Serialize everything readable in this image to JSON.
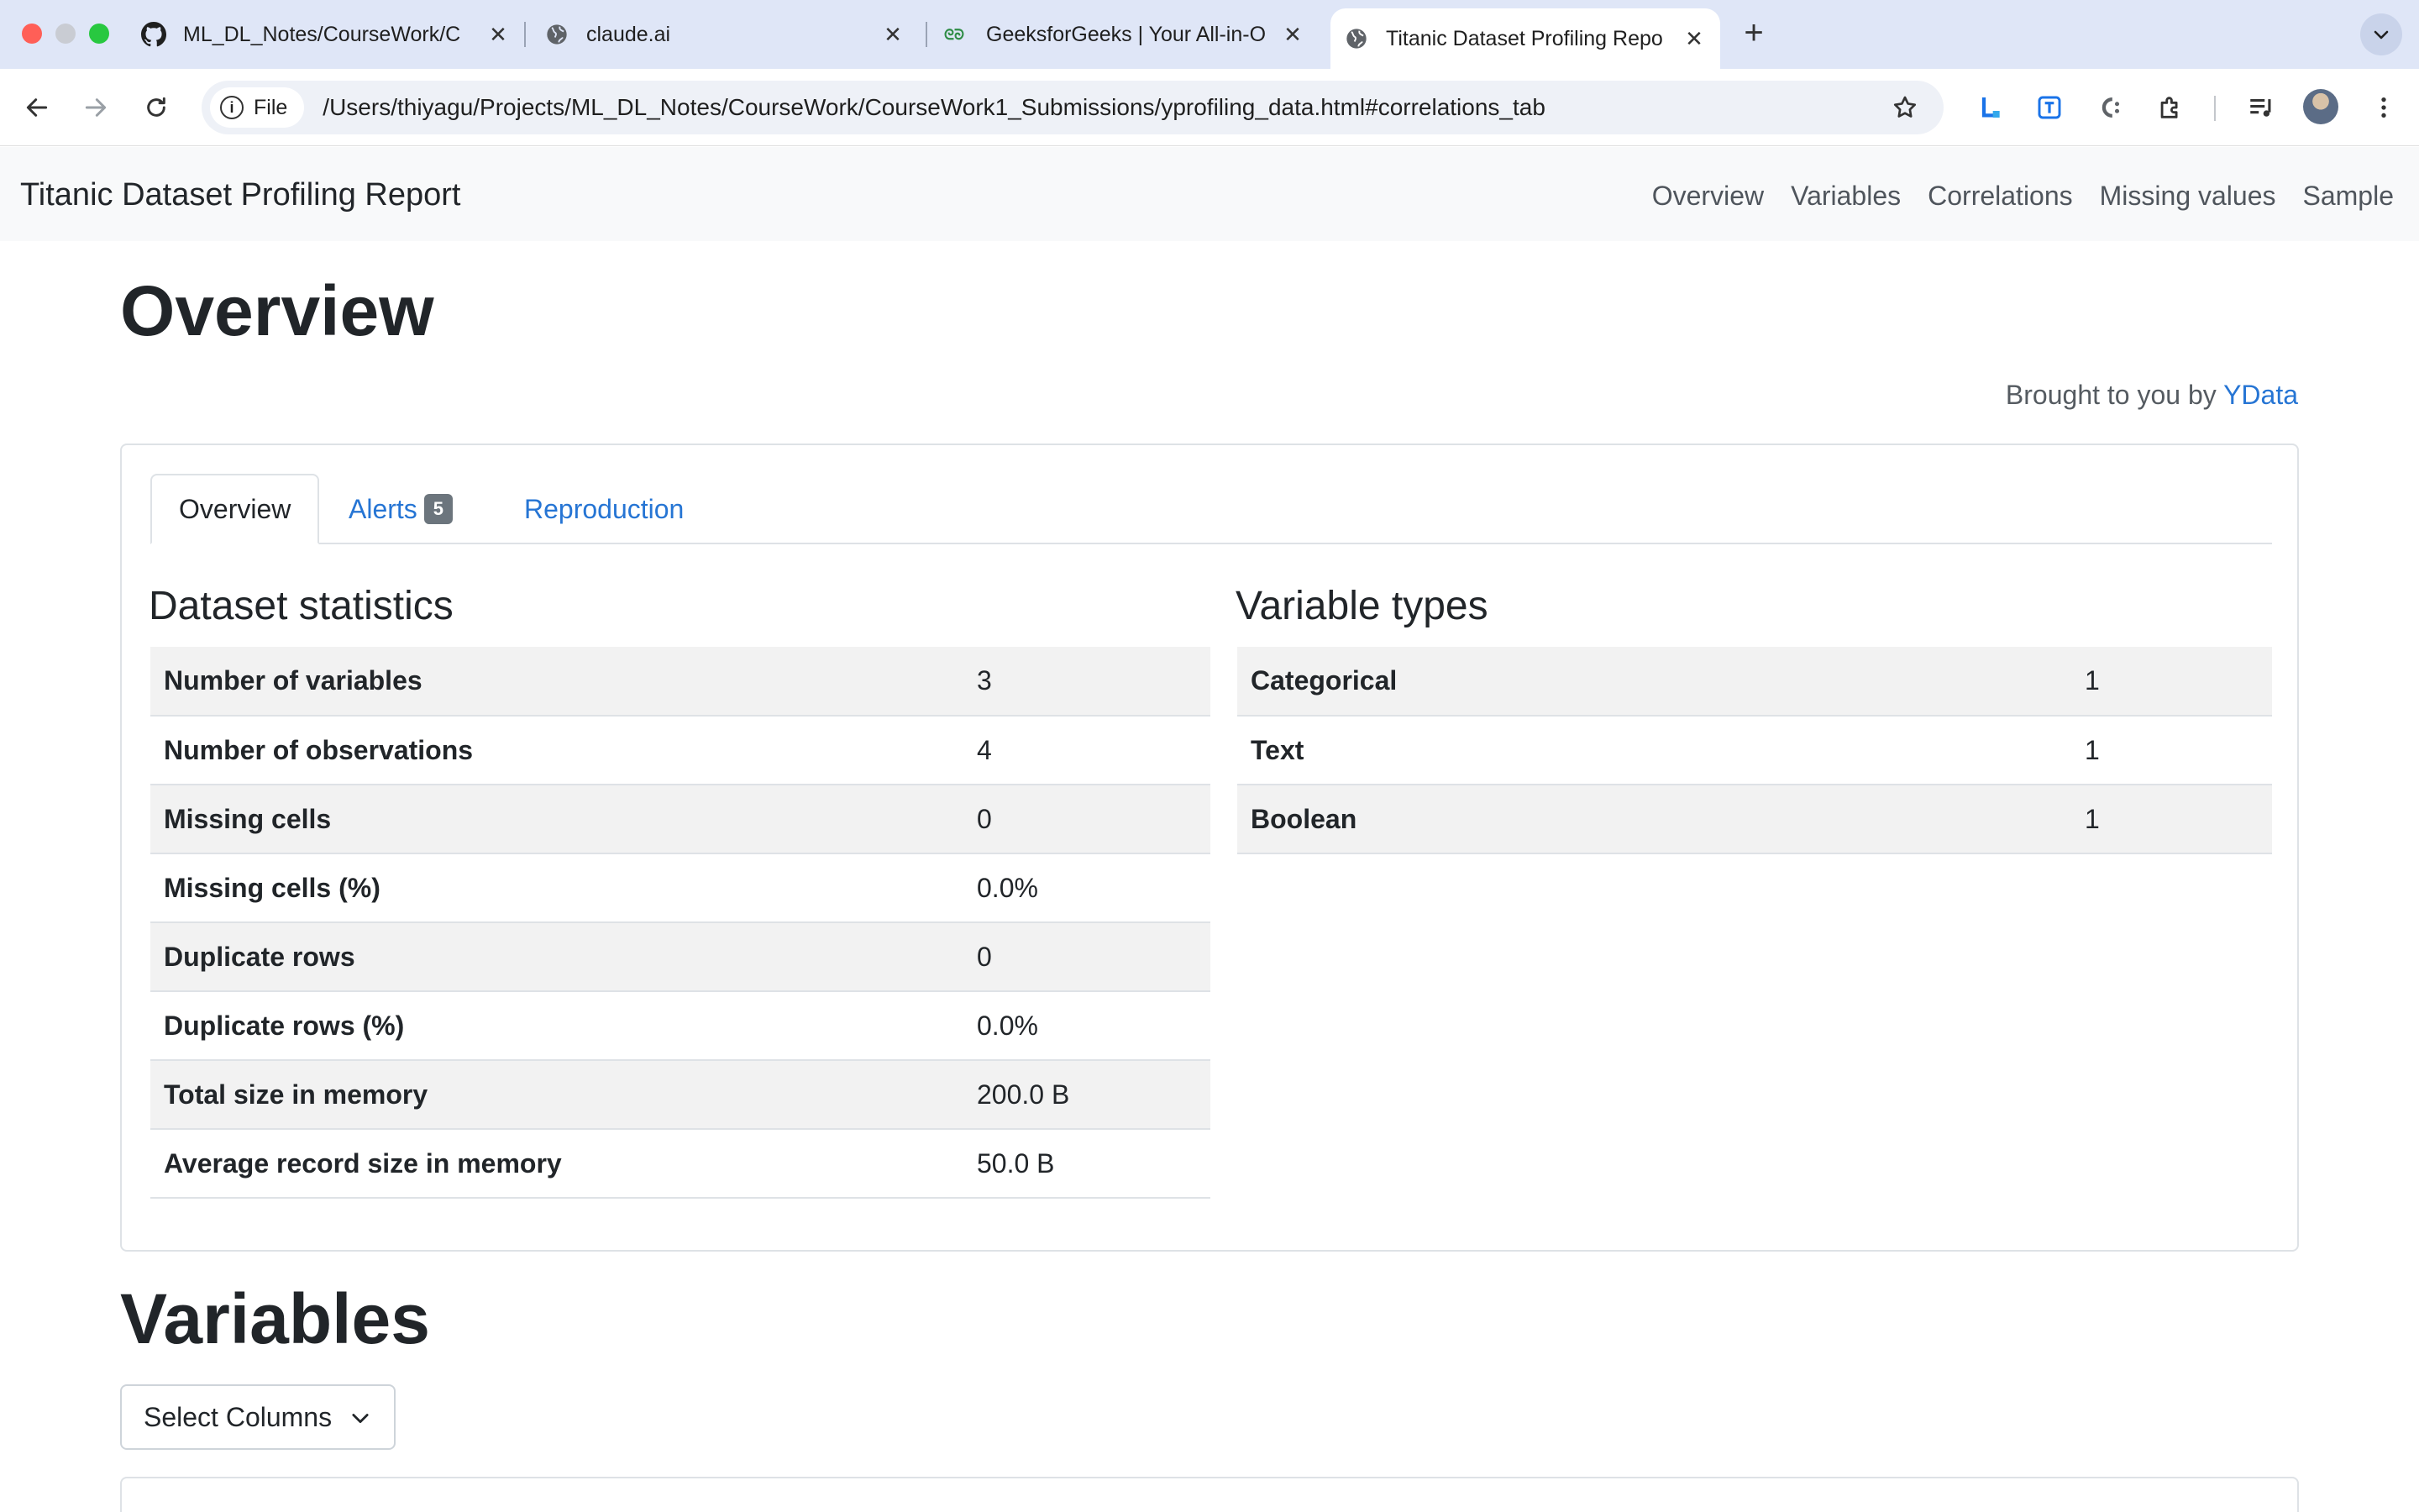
{
  "browser": {
    "tabs": [
      {
        "title": "ML_DL_Notes/CourseWork/C",
        "icon": "github-icon"
      },
      {
        "title": "claude.ai",
        "icon": "globe-icon"
      },
      {
        "title": "GeeksforGeeks | Your All-in-O",
        "icon": "gfg-icon"
      },
      {
        "title": "Titanic Dataset Profiling Repo",
        "icon": "globe-icon",
        "active": true
      }
    ],
    "chip_label": "File",
    "url": "/Users/thiyagu/Projects/ML_DL_Notes/CourseWork/CourseWork1_Submissions/yprofiling_data.html#correlations_tab"
  },
  "report": {
    "brand": "Titanic Dataset Profiling Report",
    "nav": [
      "Overview",
      "Variables",
      "Correlations",
      "Missing values",
      "Sample"
    ],
    "overview_heading": "Overview",
    "brought_prefix": "Brought to you by",
    "brought_link": "YData",
    "tabs": {
      "overview": "Overview",
      "alerts": "Alerts",
      "alerts_count": "5",
      "reproduction": "Reproduction"
    },
    "dataset_statistics": {
      "title": "Dataset statistics",
      "rows": [
        {
          "label": "Number of variables",
          "value": "3"
        },
        {
          "label": "Number of observations",
          "value": "4"
        },
        {
          "label": "Missing cells",
          "value": "0"
        },
        {
          "label": "Missing cells (%)",
          "value": "0.0%"
        },
        {
          "label": "Duplicate rows",
          "value": "0"
        },
        {
          "label": "Duplicate rows (%)",
          "value": "0.0%"
        },
        {
          "label": "Total size in memory",
          "value": "200.0 B"
        },
        {
          "label": "Average record size in memory",
          "value": "50.0 B"
        }
      ]
    },
    "variable_types": {
      "title": "Variable types",
      "rows": [
        {
          "label": "Categorical",
          "value": "1"
        },
        {
          "label": "Text",
          "value": "1"
        },
        {
          "label": "Boolean",
          "value": "1"
        }
      ]
    },
    "variables_heading": "Variables",
    "select_columns": "Select Columns"
  }
}
